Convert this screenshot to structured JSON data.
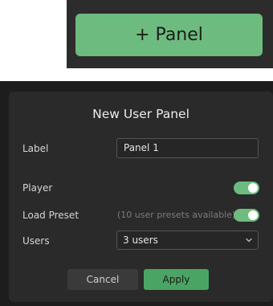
{
  "top_bar": {
    "add_panel_label": "+ Panel"
  },
  "dialog": {
    "title": "New User Panel",
    "label_field": {
      "label": "Label",
      "value": "Panel 1"
    },
    "player": {
      "label": "Player",
      "enabled": true
    },
    "load_preset": {
      "label": "Load Preset",
      "hint": "(10 user presets available)",
      "enabled": true
    },
    "users": {
      "label": "Users",
      "selected": "3 users"
    },
    "buttons": {
      "cancel": "Cancel",
      "apply": "Apply"
    }
  },
  "colors": {
    "accent_green": "#6dbb7e",
    "apply_green": "#4aa564",
    "dialog_bg": "#2a2a2a",
    "page_bg": "#1d1d1d"
  },
  "icons": {
    "select_chevron": "chevron-down-icon"
  }
}
